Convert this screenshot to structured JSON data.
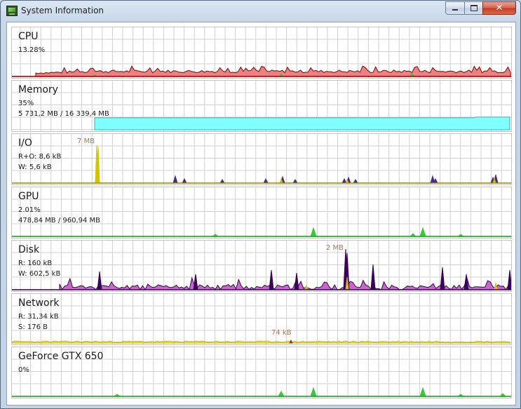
{
  "window": {
    "title": "System Information",
    "icon": "system-monitor-icon",
    "controls": {
      "minimize": "minimize-icon",
      "maximize": "maximize-icon",
      "close": "close-icon"
    }
  },
  "colors": {
    "cpu_fill": "#f08080",
    "cpu_stroke": "#8b0000",
    "cpu_kernel": "#33cc33",
    "memory_fill": "#80ffff",
    "io_read": "#d4c300",
    "io_write": "#4a2a8a",
    "gpu_fill": "#33cc33",
    "disk_read": "#8b0000",
    "disk_write": "#cc66cc",
    "disk_stroke": "#3a005a",
    "net_read": "#c8b400",
    "net_send": "#8b3a3a",
    "gridline": "#d0d0d0"
  },
  "panels": [
    {
      "key": "cpu",
      "title": "CPU",
      "line1": "13.28%",
      "line2": ""
    },
    {
      "key": "memory",
      "title": "Memory",
      "line1": "35%",
      "line2": "5 731,2 MB / 16 339,4 MB"
    },
    {
      "key": "io",
      "title": "I/O",
      "line1": "R+O: 8,6 kB",
      "line2": "W: 5,6 kB",
      "peak_label": "7 MB"
    },
    {
      "key": "gpu",
      "title": "GPU",
      "line1": "2.01%",
      "line2": "478,84 MB / 960,94 MB"
    },
    {
      "key": "disk",
      "title": "Disk",
      "line1": "R: 160 kB",
      "line2": "W: 602,5 kB",
      "peak_label": "2 MB"
    },
    {
      "key": "network",
      "title": "Network",
      "line1": "R: 31,34 kB",
      "line2": "S: 176 B",
      "peak_label": "74 kB"
    },
    {
      "key": "gpu_device",
      "title": "GeForce GTX 650",
      "line1": "0%",
      "line2": ""
    }
  ],
  "graphs": {
    "cpu_level_percent": 13.28,
    "memory_level_percent": 35,
    "gpu_level_percent": 2.01
  }
}
